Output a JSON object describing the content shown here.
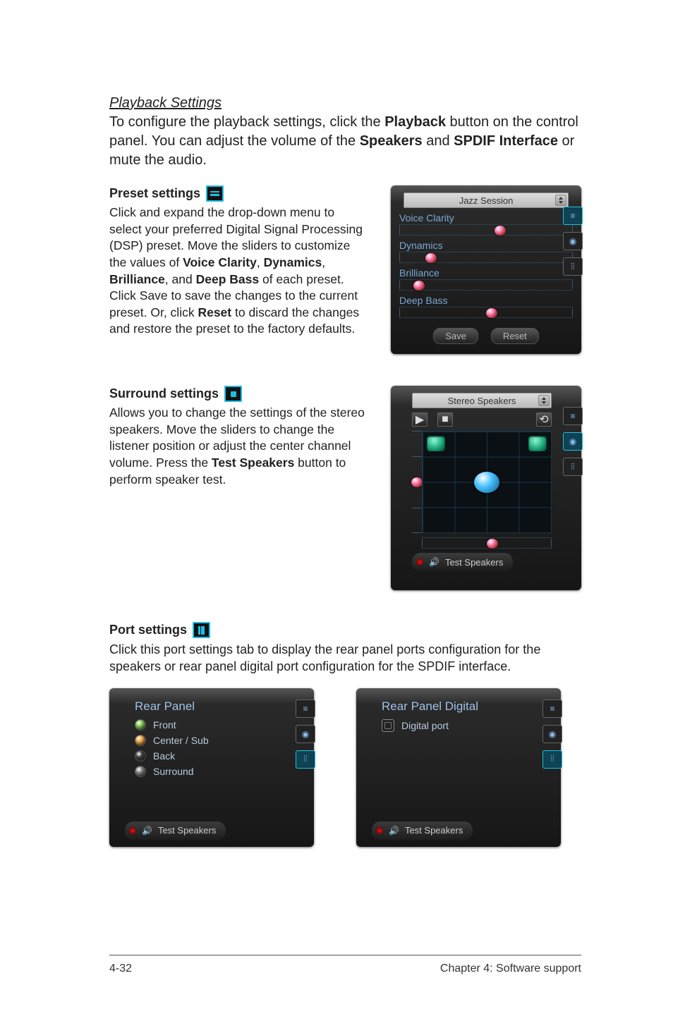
{
  "section_title": "Playback Settings",
  "intro": {
    "t0": "To configure the playback settings, click the ",
    "b0": "Playback",
    "t1": " button on the control panel. You can adjust the volume of the ",
    "b1": "Speakers",
    "t2": " and ",
    "b2": "SPDIF Interface",
    "t3": " or mute the audio."
  },
  "preset": {
    "heading": "Preset settings",
    "p_t0": "Click and expand the drop-down menu to select your preferred Digital Signal Processing (DSP) preset. Move the sliders to customize the values of ",
    "p_b0": "Voice Clarity",
    "p_t1": ", ",
    "p_b1": "Dynamics",
    "p_t2": ", ",
    "p_b2": "Brilliance",
    "p_t3": ", and ",
    "p_b3": "Deep Bass",
    "p_t4": " of each preset. Click Save to save the changes to the current preset. Or, click ",
    "p_b4": "Reset",
    "p_t5": " to discard the changes and restore the preset to the factory defaults."
  },
  "preset_panel": {
    "dropdown": "Jazz Session",
    "sliders": {
      "voice_clarity": "Voice Clarity",
      "dynamics": "Dynamics",
      "brilliance": "Brilliance",
      "deep_bass": "Deep Bass"
    },
    "buttons": {
      "save": "Save",
      "reset": "Reset"
    }
  },
  "surround": {
    "heading": "Surround settings",
    "p_t0": "Allows you to change the settings of the stereo speakers. Move the sliders to change the listener position or adjust the center channel volume. Press the ",
    "p_b0": "Test Speakers",
    "p_t1": " button to perform speaker test."
  },
  "surround_panel": {
    "dropdown": "Stereo Speakers",
    "test_label": "Test Speakers"
  },
  "port": {
    "heading": "Port settings",
    "para": "Click this port settings tab to display the rear panel ports configuration for the speakers or rear panel digital port configuration for the SPDIF interface."
  },
  "port_left": {
    "title": "Rear Panel",
    "items": [
      "Front",
      "Center / Sub",
      "Back",
      "Surround"
    ],
    "colors": [
      "#7fc64f",
      "#e8a33b",
      "#3a3a3a",
      "#7f7f7f"
    ],
    "test_label": "Test Speakers"
  },
  "port_right": {
    "title": "Rear Panel Digital",
    "item": "Digital port",
    "test_label": "Test Speakers"
  },
  "footer": {
    "left": "4-32",
    "right": "Chapter 4: Software support"
  },
  "icons": {
    "preset": "equalizer-icon",
    "surround": "surround-icon",
    "port": "ports-icon",
    "speaker": "🔊",
    "play": "▶",
    "stop": "■",
    "loop": "⟲"
  }
}
